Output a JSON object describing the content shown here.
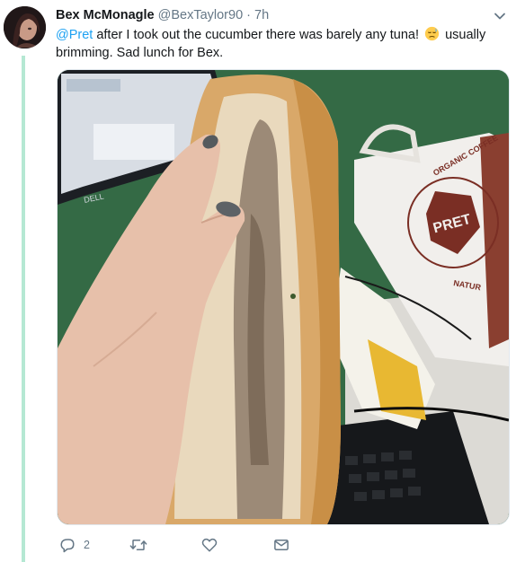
{
  "tweet": {
    "author_name": "Bex McMonagle",
    "handle": "@BexTaylor90",
    "separator": "·",
    "time": "7h",
    "mention": "@Pret",
    "text_before_emoji": " after I took out the cucumber there was barely any tuna! ",
    "emoji_icon": "disappointed-face-emoji",
    "text_after_emoji": " usually brimming. Sad lunch for Bex."
  },
  "actions": {
    "reply_count": "2",
    "reply_icon": "reply-icon",
    "retweet_icon": "retweet-icon",
    "like_icon": "heart-icon",
    "dm_icon": "envelope-icon"
  },
  "media": {
    "bag_text_top": "ORGANIC COFFEE",
    "bag_text_bottom": "NATUR",
    "bag_logo_text": "PRET",
    "monitor_brand": "DELL"
  },
  "colors": {
    "link": "#1da1f2",
    "secondary_text": "#657786",
    "thread_line": "#b5e8d3"
  }
}
